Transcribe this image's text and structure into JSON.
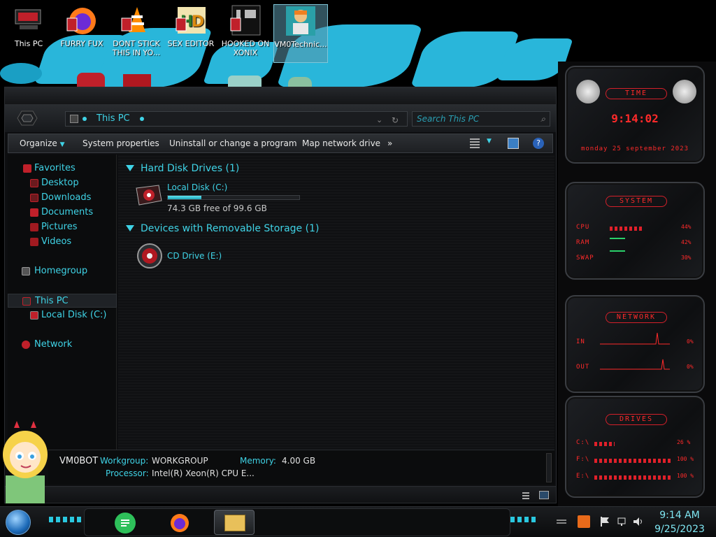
{
  "desktop": {
    "icons": [
      {
        "label": "This PC",
        "selected": false
      },
      {
        "label": "FURRY FUX",
        "selected": false
      },
      {
        "label": "DONT STICK THIS IN YO...",
        "selected": false
      },
      {
        "label": "SEX EDITOR",
        "selected": false
      },
      {
        "label": "HOOKED ON XONIX",
        "selected": false
      },
      {
        "label": "VM0Technic...",
        "selected": true
      }
    ]
  },
  "explorer": {
    "address": "This PC",
    "search_placeholder": "Search This PC",
    "toolbar": {
      "organize": "Organize",
      "system_properties": "System properties",
      "uninstall": "Uninstall or change a program",
      "map_drive": "Map network drive",
      "more": "»"
    },
    "sidebar": {
      "favorites": "Favorites",
      "desktop": "Desktop",
      "downloads": "Downloads",
      "documents": "Documents",
      "pictures": "Pictures",
      "videos": "Videos",
      "homegroup": "Homegroup",
      "this_pc": "This PC",
      "local_disk": "Local Disk (C:)",
      "network": "Network"
    },
    "groups": {
      "hdd": "Hard Disk Drives (1)",
      "removable": "Devices with Removable Storage (1)"
    },
    "drives": {
      "c_label": "Local Disk (C:)",
      "c_free": "74.3 GB free of 99.6 GB",
      "c_used_fraction": 0.254,
      "cd_label": "CD Drive (E:)"
    },
    "details": {
      "computer": "VM0BOT",
      "workgroup_label": "Workgroup:",
      "workgroup": "WORKGROUP",
      "memory_label": "Memory:",
      "memory": "4.00 GB",
      "processor_label": "Processor:",
      "processor": "Intel(R) Xeon(R) CPU E..."
    }
  },
  "gadgets": {
    "time": {
      "title": "TIME",
      "clock": "9:14:02",
      "date": "monday 25 september 2023"
    },
    "system": {
      "title": "SYSTEM",
      "cpu_label": "CPU",
      "cpu": "44%",
      "cpu_fraction": 0.44,
      "ram_label": "RAM",
      "ram": "42%",
      "ram_fraction": 0.42,
      "swap_label": "SWAP",
      "swap": "30%",
      "swap_fraction": 0.3
    },
    "network": {
      "title": "NETWORK",
      "in_label": "IN",
      "in": "0%",
      "out_label": "OUT",
      "out": "0%"
    },
    "drives": {
      "title": "DRIVES",
      "c_label": "C:\\",
      "c": "26 %",
      "c_fraction": 0.26,
      "f_label": "F:\\",
      "f": "100 %",
      "f_fraction": 1.0,
      "e_label": "E:\\",
      "e": "100 %",
      "e_fraction": 1.0
    }
  },
  "taskbar": {
    "time": "9:14 AM",
    "date": "9/25/2023"
  },
  "colors": {
    "accent": "#3fd3e6",
    "gadget_red": "#ff2a2a",
    "wallpaper_blue": "#29b6da"
  }
}
